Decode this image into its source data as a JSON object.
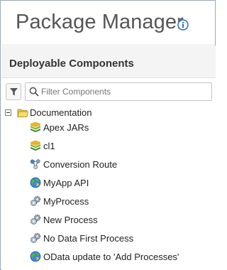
{
  "header": {
    "title": "Package Manager",
    "info_icon": "info-icon"
  },
  "section": {
    "title": "Deployable Components"
  },
  "filter": {
    "icon": "filter-icon",
    "search_icon": "search-icon",
    "placeholder": "Filter Components",
    "value": ""
  },
  "tree": {
    "root": {
      "label": "Documentation",
      "expanded": true,
      "icon": "folder-icon"
    },
    "items": [
      {
        "label": "Apex JARs",
        "icon": "jar-icon"
      },
      {
        "label": "cl1",
        "icon": "jar-icon"
      },
      {
        "label": "Conversion Route",
        "icon": "route-icon"
      },
      {
        "label": "MyApp API",
        "icon": "api-globe-icon"
      },
      {
        "label": "MyProcess",
        "icon": "process-gear-icon"
      },
      {
        "label": "New Process",
        "icon": "process-gear-icon"
      },
      {
        "label": "No Data First Process",
        "icon": "process-gear-icon"
      },
      {
        "label": "OData update to 'Add Processes'",
        "icon": "api-globe-icon"
      }
    ]
  },
  "colors": {
    "border": "#9aa9b8",
    "info_blue": "#2d72b8",
    "section_bg": "#f4f4f4"
  }
}
